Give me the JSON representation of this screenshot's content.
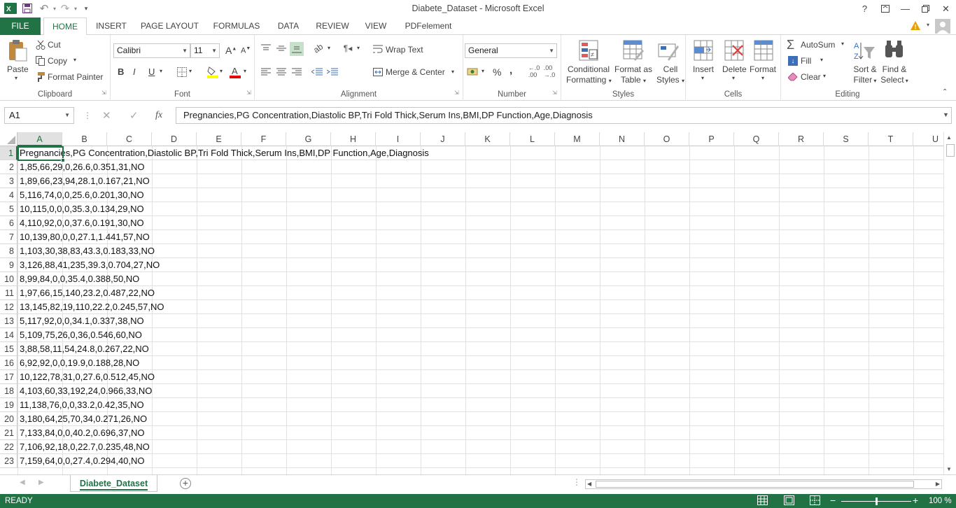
{
  "window": {
    "title": "Diabete_Dataset - Microsoft Excel"
  },
  "tabs": [
    "FILE",
    "HOME",
    "INSERT",
    "PAGE LAYOUT",
    "FORMULAS",
    "DATA",
    "REVIEW",
    "VIEW",
    "PDFelement"
  ],
  "clipboard": {
    "paste": "Paste",
    "cut": "Cut",
    "copy": "Copy",
    "format_painter": "Format Painter",
    "label": "Clipboard"
  },
  "font": {
    "name": "Calibri",
    "size": "11",
    "bold": "B",
    "italic": "I",
    "underline": "U",
    "label": "Font",
    "grow": "A",
    "shrink": "A"
  },
  "alignment": {
    "wrap_text": "Wrap Text",
    "merge_center": "Merge & Center",
    "label": "Alignment"
  },
  "number": {
    "format": "General",
    "percent": "%",
    "comma": ",",
    "label": "Number"
  },
  "styles": {
    "conditional": [
      "Conditional",
      "Formatting"
    ],
    "format_table": [
      "Format as",
      "Table"
    ],
    "cell_styles": [
      "Cell",
      "Styles"
    ],
    "label": "Styles"
  },
  "cells": {
    "insert": "Insert",
    "delete": "Delete",
    "format": "Format",
    "label": "Cells"
  },
  "editing": {
    "autosum": "AutoSum",
    "fill": "Fill",
    "clear": "Clear",
    "sort": [
      "Sort &",
      "Filter"
    ],
    "find": [
      "Find &",
      "Select"
    ],
    "label": "Editing"
  },
  "formula_bar": {
    "name_box": "A1",
    "fx": "fx",
    "content": "Pregnancies,PG Concentration,Diastolic BP,Tri Fold Thick,Serum Ins,BMI,DP Function,Age,Diagnosis"
  },
  "columns": [
    "A",
    "B",
    "C",
    "D",
    "E",
    "F",
    "G",
    "H",
    "I",
    "J",
    "K",
    "L",
    "M",
    "N",
    "O",
    "P",
    "Q",
    "R",
    "S",
    "T",
    "U"
  ],
  "rows": [
    {
      "n": "1",
      "text": "Pregnancies,PG Concentration,Diastolic BP,Tri Fold Thick,Serum Ins,BMI,DP Function,Age,Diagnosis"
    },
    {
      "n": "2",
      "text": "1,85,66,29,0,26.6,0.351,31,NO"
    },
    {
      "n": "3",
      "text": "1,89,66,23,94,28.1,0.167,21,NO"
    },
    {
      "n": "4",
      "text": "5,116,74,0,0,25.6,0.201,30,NO"
    },
    {
      "n": "5",
      "text": "10,115,0,0,0,35.3,0.134,29,NO"
    },
    {
      "n": "6",
      "text": "4,110,92,0,0,37.6,0.191,30,NO"
    },
    {
      "n": "7",
      "text": "10,139,80,0,0,27.1,1.441,57,NO"
    },
    {
      "n": "8",
      "text": "1,103,30,38,83,43.3,0.183,33,NO"
    },
    {
      "n": "9",
      "text": "3,126,88,41,235,39.3,0.704,27,NO"
    },
    {
      "n": "10",
      "text": "8,99,84,0,0,35.4,0.388,50,NO"
    },
    {
      "n": "11",
      "text": "1,97,66,15,140,23.2,0.487,22,NO"
    },
    {
      "n": "12",
      "text": "13,145,82,19,110,22.2,0.245,57,NO"
    },
    {
      "n": "13",
      "text": "5,117,92,0,0,34.1,0.337,38,NO"
    },
    {
      "n": "14",
      "text": "5,109,75,26,0,36,0.546,60,NO"
    },
    {
      "n": "15",
      "text": "3,88,58,11,54,24.8,0.267,22,NO"
    },
    {
      "n": "16",
      "text": "6,92,92,0,0,19.9,0.188,28,NO"
    },
    {
      "n": "17",
      "text": "10,122,78,31,0,27.6,0.512,45,NO"
    },
    {
      "n": "18",
      "text": "4,103,60,33,192,24,0.966,33,NO"
    },
    {
      "n": "19",
      "text": "11,138,76,0,0,33.2,0.42,35,NO"
    },
    {
      "n": "20",
      "text": "3,180,64,25,70,34,0.271,26,NO"
    },
    {
      "n": "21",
      "text": "7,133,84,0,0,40.2,0.696,37,NO"
    },
    {
      "n": "22",
      "text": "7,106,92,18,0,22.7,0.235,48,NO"
    },
    {
      "n": "23",
      "text": "7,159,64,0,0,27.4,0.294,40,NO"
    }
  ],
  "sheet": {
    "name": "Diabete_Dataset"
  },
  "status": {
    "text": "READY",
    "zoom": "100 %",
    "zoom_level": 1.0
  },
  "colors": {
    "accent": "#217346",
    "warning": "#e8a200"
  },
  "icons": [
    "excel-icon",
    "save-icon",
    "undo-icon",
    "redo-icon",
    "help-icon",
    "ribbon-display-icon",
    "minimize-icon",
    "restore-icon",
    "close-icon"
  ]
}
